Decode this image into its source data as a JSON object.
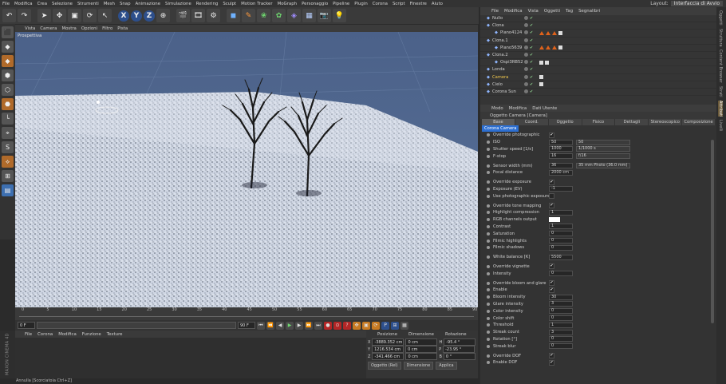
{
  "menubar": {
    "items": [
      "File",
      "Modifica",
      "Crea",
      "Selezione",
      "Strumenti",
      "Mesh",
      "Snap",
      "Animazione",
      "Simulazione",
      "Rendering",
      "Sculpt",
      "Motion Tracker",
      "MoGraph",
      "Personaggio",
      "Pipeline",
      "Plugin",
      "Corona",
      "Script",
      "Finestre",
      "Aiuto"
    ],
    "layout_label": "Layout:",
    "layout_value": "Interfaccia di Avvio"
  },
  "viewport": {
    "menu": [
      "Vista",
      "Camera",
      "Mostra",
      "Opzioni",
      "Filtro",
      "Pista"
    ],
    "label": "Prospettiva"
  },
  "timeline": {
    "ticks": [
      "0",
      "5",
      "10",
      "15",
      "20",
      "25",
      "30",
      "35",
      "40",
      "45",
      "50",
      "55",
      "60",
      "65",
      "70",
      "75",
      "80",
      "85",
      "90"
    ],
    "frame_start": "0 F",
    "frame_end": "90 F"
  },
  "material_manager": {
    "menu": [
      "File",
      "Corona",
      "Modifica",
      "Funzione",
      "Texture"
    ]
  },
  "coordinates": {
    "headers": [
      "Posizione",
      "Dimensione",
      "Rotazione"
    ],
    "rows": [
      {
        "axis": "X",
        "pos": "-3889.352 cm",
        "dim": "0 cm",
        "rot_axis": "H",
        "rot": "-95.4 °"
      },
      {
        "axis": "Y",
        "pos": "1216.534 cm",
        "dim": "0 cm",
        "rot_axis": "P",
        "rot": "-23.95 °"
      },
      {
        "axis": "Z",
        "pos": "-341.466 cm",
        "dim": "0 cm",
        "rot_axis": "B",
        "rot": "0 °"
      }
    ],
    "mode": "Oggetto (Rel)",
    "size_mode": "Dimensione",
    "apply": "Applica"
  },
  "status": "Annulla [Scorciatoia Ctrl+Z]",
  "brand": "MAXON CINEMA 4D",
  "object_manager": {
    "menu": [
      "File",
      "Modifica",
      "Vista",
      "Oggetti",
      "Tag",
      "Segnalibri"
    ],
    "objects": [
      {
        "name": "Nullo",
        "tags": 0
      },
      {
        "name": "Clona",
        "tags": 0
      },
      {
        "name": "Piano4124",
        "tags": 4
      },
      {
        "name": "Clona.1",
        "tags": 0
      },
      {
        "name": "Piano5639",
        "tags": 4
      },
      {
        "name": "Clona.2",
        "tags": 0
      },
      {
        "name": "Ospi3RB52",
        "tags": 2
      },
      {
        "name": "Londa",
        "tags": 0
      },
      {
        "name": "Camera",
        "tags": 1
      },
      {
        "name": "Cielo",
        "tags": 1
      },
      {
        "name": "Corona Sun",
        "tags": 0
      }
    ]
  },
  "attributes": {
    "menu": [
      "Modo",
      "Modifica",
      "Dati Utente"
    ],
    "title": "Oggetto Camera [Camera]",
    "tabs": [
      "Base",
      "Coord.",
      "Oggetto",
      "Fisico",
      "Dettagli",
      "Stereoscopico",
      "Composizione"
    ],
    "subtab": "Corona Camera",
    "props": [
      {
        "label": "Override photographic",
        "check": "✔"
      },
      {
        "label": "ISO",
        "v1": "50",
        "v2": "50"
      },
      {
        "label": "Shutter speed [1/s]",
        "v1": "1000",
        "v2": "1/1000 s"
      },
      {
        "label": "F-stop",
        "v1": "16",
        "v2": "f/16"
      },
      {
        "sep": true
      },
      {
        "label": "Sensor width (mm)",
        "v1": "36",
        "v2": "35 mm Photo (36.0 mm)"
      },
      {
        "label": "Focal distance",
        "v1": "2000 cm"
      },
      {
        "sep": true
      },
      {
        "label": "Override exposure",
        "check": "✔"
      },
      {
        "label": "Exposure (EV)",
        "v1": "-1"
      },
      {
        "label": "Use photographic exposure",
        "check": ""
      },
      {
        "sep": true
      },
      {
        "label": "Override tone mapping",
        "check": "✔"
      },
      {
        "label": "Highlight compression",
        "v1": "1"
      },
      {
        "label": "RGB channels output",
        "swatch": "#ffffff"
      },
      {
        "label": "Contrast",
        "v1": "1"
      },
      {
        "label": "Saturation",
        "v1": "0"
      },
      {
        "label": "Filmic highlights",
        "v1": "0"
      },
      {
        "label": "Filmic shadows",
        "v1": "0"
      },
      {
        "sep": true
      },
      {
        "label": "White balance [K]",
        "v1": "5500"
      },
      {
        "sep": true
      },
      {
        "label": "Override vignette",
        "check": "✔"
      },
      {
        "label": "Intensity",
        "v1": "0"
      },
      {
        "sep": true
      },
      {
        "label": "Override bloom and glare",
        "check": "✔"
      },
      {
        "label": "Enable",
        "check": "✔"
      },
      {
        "label": "Bloom intensity",
        "v1": "30"
      },
      {
        "label": "Glare intensity",
        "v1": "3"
      },
      {
        "label": "Color intensity",
        "v1": "0"
      },
      {
        "label": "Color shift",
        "v1": "0"
      },
      {
        "label": "Threshold",
        "v1": "1"
      },
      {
        "label": "Streak count",
        "v1": "3"
      },
      {
        "label": "Rotation [°]",
        "v1": "0"
      },
      {
        "label": "Streak blur",
        "v1": "0"
      },
      {
        "sep": true
      },
      {
        "label": "Override DOF",
        "check": "✔"
      },
      {
        "label": "Enable DOF",
        "check": "✔"
      }
    ]
  },
  "right_strip": [
    "Oggetti",
    "Struttura",
    "Content Browser",
    "Strati",
    "Attributi",
    "Livelli"
  ]
}
